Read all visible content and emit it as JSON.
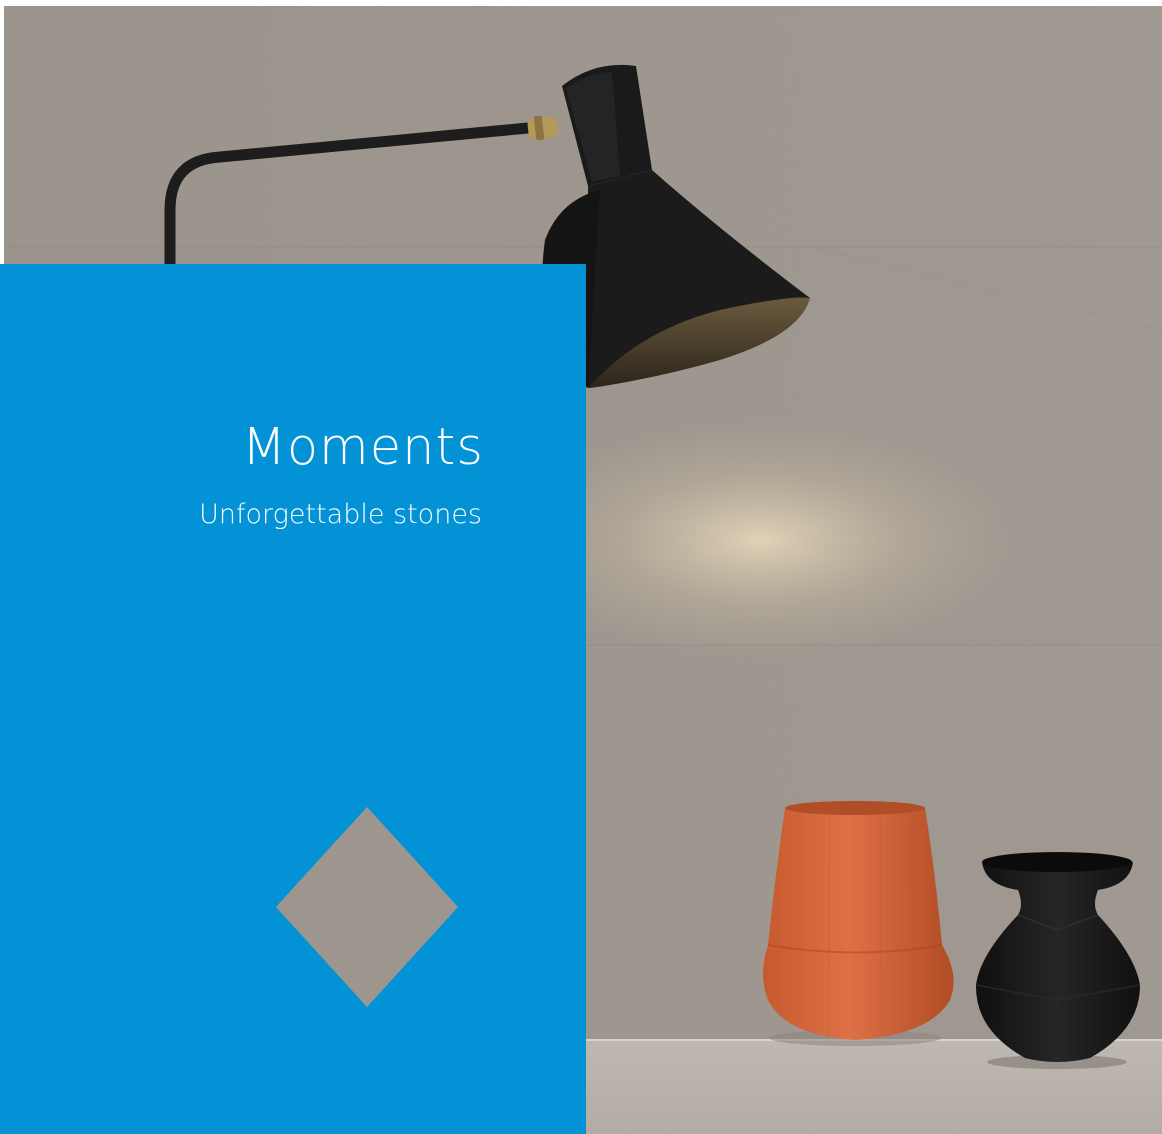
{
  "panel": {
    "title": "Moments",
    "subtitle": "Unforgettable stones"
  },
  "colors": {
    "panel_blue": "#0392d6",
    "wall_stone": "#a59d94",
    "lamp_black": "#1b1b1b",
    "brass": "#b49a5a",
    "terracotta_vase": "#d56537",
    "black_vase": "#181818",
    "surface": "#bdb7b1"
  },
  "scene": {
    "objects": [
      "wall-lamp-icon",
      "terracotta-vase-icon",
      "black-vase-icon",
      "stone-diamond-swatch"
    ]
  }
}
